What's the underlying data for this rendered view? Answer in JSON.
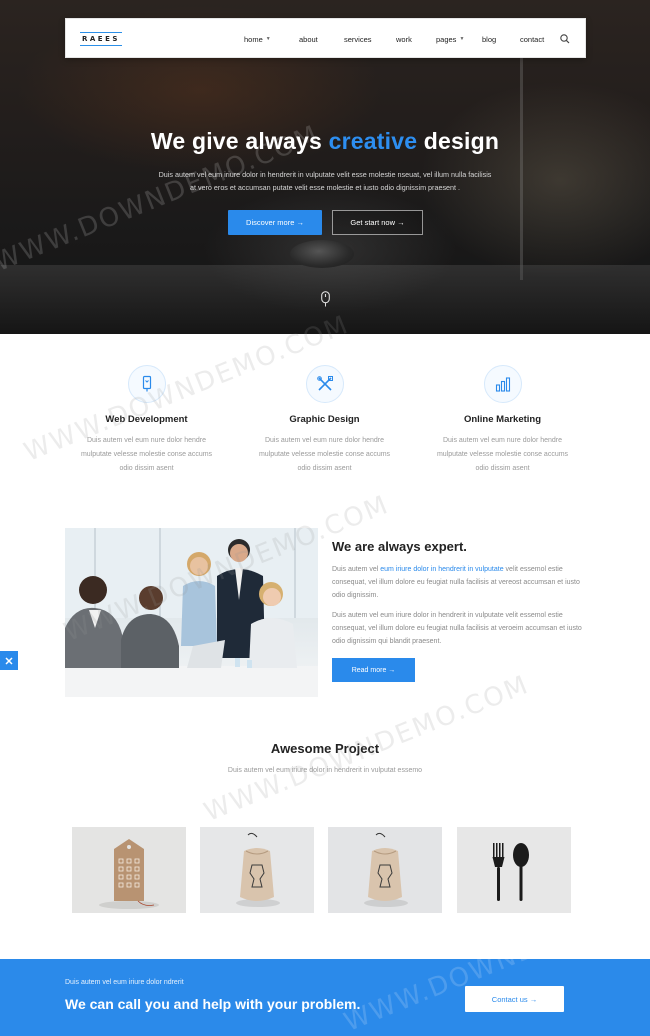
{
  "nav": {
    "logo": "RAEES",
    "items": [
      {
        "label": "home",
        "dropdown": true
      },
      {
        "label": "about",
        "dropdown": false
      },
      {
        "label": "services",
        "dropdown": false
      },
      {
        "label": "work",
        "dropdown": false
      },
      {
        "label": "pages",
        "dropdown": true
      },
      {
        "label": "blog",
        "dropdown": false
      },
      {
        "label": "contact",
        "dropdown": false
      }
    ],
    "search_icon": "search-icon"
  },
  "hero": {
    "title_before": "We give always ",
    "title_accent": "creative",
    "title_after": " design",
    "text_line1": "Duis autem vel eum iriure dolor in hendrerit in vulputate velit esse molestie nseuat, vel illum nulla facilisis",
    "text_line2": "at vero eros et accumsan putate velit esse molestie et iusto odio dignissim praesent .",
    "btn_primary": "Discover more  →",
    "btn_secondary": "Get start now  →",
    "accent_color": "#2d8ef0"
  },
  "services": [
    {
      "icon": "mobile-icon",
      "title": "Web Development",
      "desc": "Duis autem vel eum nure dolor hendre mulputate velesse molestie conse accums odio dissim asent"
    },
    {
      "icon": "tools-icon",
      "title": "Graphic Design",
      "desc": "Duis autem vel eum nure dolor hendre mulputate velesse molestie conse accums odio dissim asent"
    },
    {
      "icon": "chart-icon",
      "title": "Online Marketing",
      "desc": "Duis autem vel eum nure dolor hendre mulputate velesse molestie conse accums odio dissim asent"
    }
  ],
  "about": {
    "title": "We are always expert.",
    "para1_before": "Duis autem vel ",
    "para1_link": "eum iriure dolor in hendrerit in vulputate",
    "para1_after": " velit essemol estie consequat, vel illum dolore eu feugiat nulla facilisis at vereost accumsan et iusto odio dignissim.",
    "para2": "Duis autem vel eum iriure dolor in hendrerit in vulputate velit essemol estie consequat, vel illum dolore eu feugiat nulla facilisis at veroeim accumsan et iusto odio dignissim qui blandit praesent.",
    "btn": "Read more  →"
  },
  "projects": {
    "title": "Awesome Project",
    "subtitle": "Duis autem vel eum iriure dolor in hendrerit in vulputat essemo",
    "items": [
      "tag-mockup",
      "pouch-mockup",
      "pouch-mockup",
      "cutlery-mockup"
    ]
  },
  "cta": {
    "small": "Duis autem vel eum iriure dolor ndrerit",
    "big": "We can call you and help with your problem.",
    "btn": "Contact us  →",
    "color": "#2b8aea"
  },
  "watermark": "WWW.DOWNDEMO.COM"
}
